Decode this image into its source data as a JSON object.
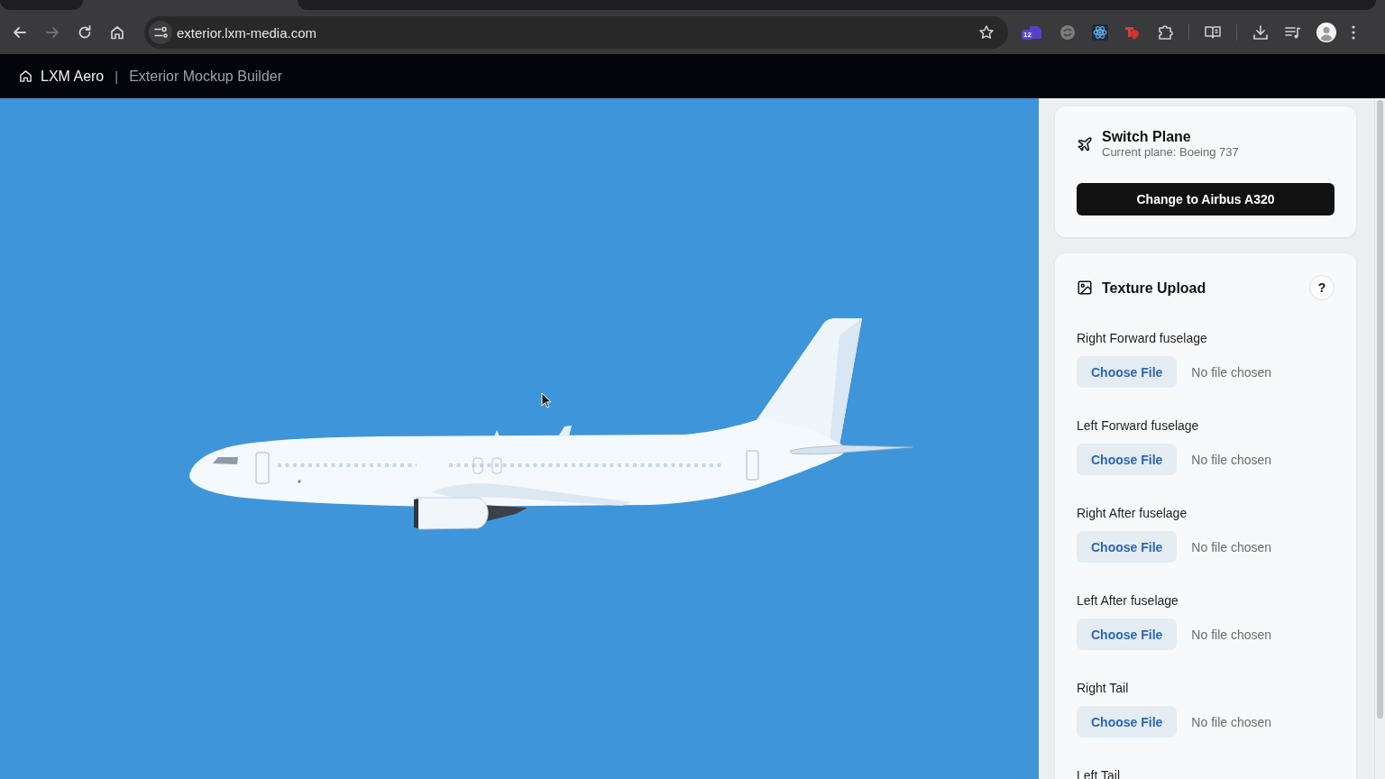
{
  "browser": {
    "nav_buttons": [
      {
        "disabled": false
      },
      {
        "disabled": true
      },
      {
        "disabled": false
      },
      {
        "disabled": false
      }
    ],
    "url": "exterior.lxm-media.com",
    "extension_badge": "12"
  },
  "app_header": {
    "brand": "LXM Aero",
    "separator": "|",
    "title": "Exterior Mockup Builder"
  },
  "switch_plane": {
    "title": "Switch Plane",
    "subtitle": "Current plane: Boeing 737",
    "button": "Change to Airbus A320"
  },
  "texture_upload": {
    "title": "Texture Upload",
    "help": "?",
    "slots": [
      {
        "label": "Right Forward fuselage",
        "button": "Choose File",
        "status": "No file chosen"
      },
      {
        "label": "Left Forward fuselage",
        "button": "Choose File",
        "status": "No file chosen"
      },
      {
        "label": "Right After fuselage",
        "button": "Choose File",
        "status": "No file chosen"
      },
      {
        "label": "Left After fuselage",
        "button": "Choose File",
        "status": "No file chosen"
      },
      {
        "label": "Right Tail",
        "button": "Choose File",
        "status": "No file chosen"
      },
      {
        "label": "Left Tail"
      }
    ]
  }
}
